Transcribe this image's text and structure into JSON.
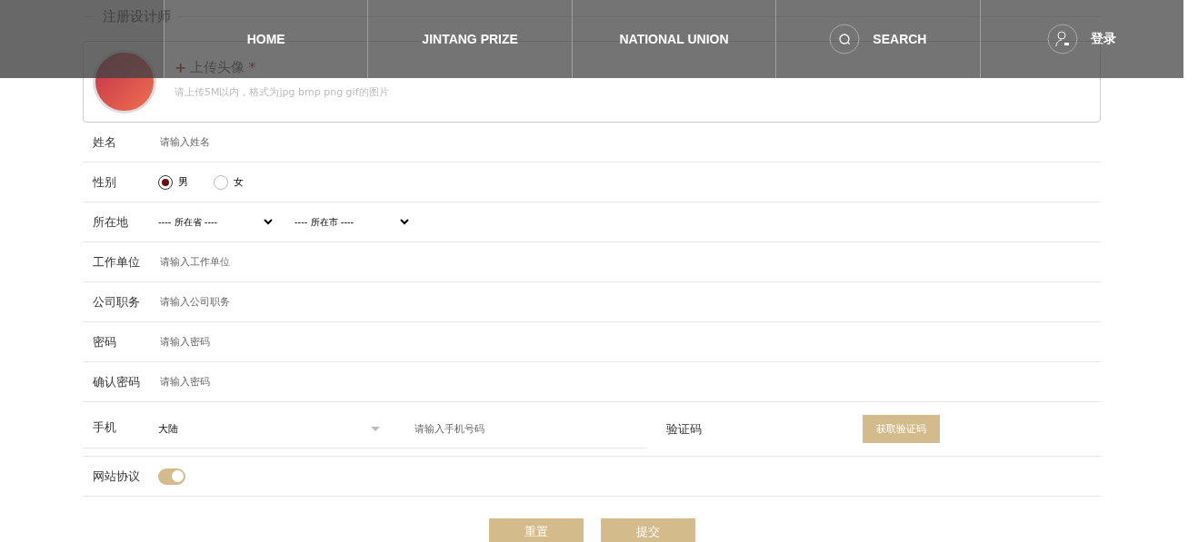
{
  "nav": {
    "items": [
      {
        "label": "HOME",
        "kind": "text"
      },
      {
        "label": "JINTANG PRIZE",
        "kind": "text"
      },
      {
        "label": "NATIONAL UNION",
        "kind": "text"
      },
      {
        "label": "SEARCH",
        "kind": "search"
      },
      {
        "label": "登录",
        "kind": "user"
      }
    ]
  },
  "form": {
    "title": "注册设计师",
    "avatar": {
      "label": "上传头像",
      "required_mark": "*",
      "plus": "+",
      "hint": "请上传5M以内，格式为jpg bmp png gif的图片"
    },
    "rows": [
      {
        "kind": "text",
        "label": "姓名",
        "placeholder": "请输入姓名"
      },
      {
        "kind": "radio",
        "label": "性别",
        "options": [
          {
            "label": "男",
            "selected": true
          },
          {
            "label": "女",
            "selected": false
          }
        ]
      },
      {
        "kind": "select",
        "label": "所在地",
        "selects": [
          "---- 所在省 ----",
          "---- 所在市 ----"
        ]
      },
      {
        "kind": "text",
        "label": "工作单位",
        "placeholder": "请输入工作单位"
      },
      {
        "kind": "text",
        "label": "公司职务",
        "placeholder": "请输入公司职务"
      },
      {
        "kind": "text",
        "label": "密码",
        "placeholder": "请输入密码"
      },
      {
        "kind": "text",
        "label": "确认密码",
        "placeholder": "请输入密码"
      },
      {
        "kind": "phone",
        "label": "手机",
        "region": "大陆",
        "placeholder": "请输入手机号码",
        "code_label": "验证码",
        "code_button": "获取验证码"
      },
      {
        "kind": "switch",
        "label": "网站协议",
        "on": true
      }
    ],
    "buttons": [
      "重置",
      "提交"
    ]
  }
}
